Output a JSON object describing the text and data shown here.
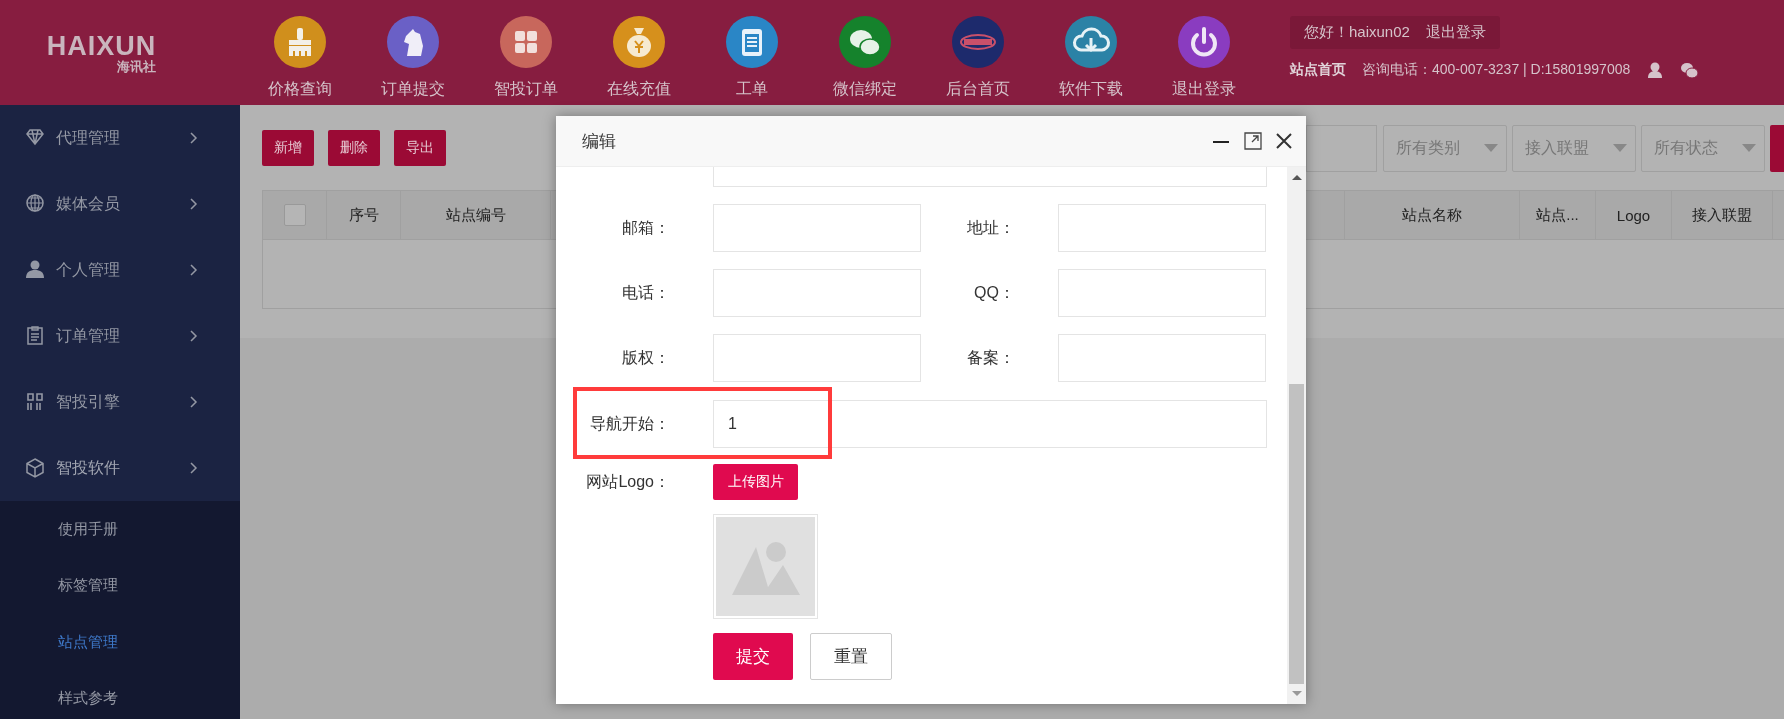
{
  "header": {
    "logo": {
      "text": "HAIXUN",
      "subtext": "海讯社"
    },
    "nav": [
      {
        "label": "价格查询",
        "kind": "brush",
        "color": "#d08f1c"
      },
      {
        "label": "订单提交",
        "kind": "horse",
        "color": "#6a60c6"
      },
      {
        "label": "智投订单",
        "kind": "grid",
        "color": "#c8675c"
      },
      {
        "label": "在线充值",
        "kind": "moneybag",
        "color": "#d6901c"
      },
      {
        "label": "工单",
        "kind": "clipboard",
        "color": "#2a86c6"
      },
      {
        "label": "微信绑定",
        "kind": "chat",
        "color": "#15822c"
      },
      {
        "label": "后台首页",
        "kind": "badge",
        "color": "#1d2a6c"
      },
      {
        "label": "软件下载",
        "kind": "cloud",
        "color": "#2b82a6"
      },
      {
        "label": "退出登录",
        "kind": "power",
        "color": "#8a3cc0"
      }
    ],
    "greeting": "您好！haixun02",
    "logout": "退出登录",
    "home_link": "站点首页",
    "contact": "咨询电话：400-007-3237 | D:15801997008"
  },
  "sidebar": {
    "items": [
      {
        "label": "代理管理",
        "kind": "diamond",
        "expanded": false
      },
      {
        "label": "媒体会员",
        "kind": "globe",
        "expanded": false
      },
      {
        "label": "个人管理",
        "kind": "person",
        "expanded": false
      },
      {
        "label": "订单管理",
        "kind": "clipboard",
        "expanded": false
      },
      {
        "label": "智投引擎",
        "kind": "bars",
        "expanded": false
      },
      {
        "label": "智投软件",
        "kind": "cube",
        "expanded": true,
        "children": [
          {
            "label": "使用手册",
            "selected": false
          },
          {
            "label": "标签管理",
            "selected": false
          },
          {
            "label": "站点管理",
            "selected": true
          },
          {
            "label": "样式参考",
            "selected": false
          }
        ]
      }
    ]
  },
  "toolbar": {
    "buttons": [
      "新增",
      "删除",
      "导出"
    ],
    "filters": [
      "所有类别",
      "接入联盟",
      "所有状态"
    ]
  },
  "table": {
    "select_all_checked": false,
    "columns_left": [
      "序号",
      "站点编号"
    ],
    "columns_right": [
      "站点名称",
      "站点...",
      "Logo",
      "接入联盟"
    ]
  },
  "dialog": {
    "title": "编辑",
    "rows": [
      [
        {
          "label": "邮箱："
        },
        {
          "label": "地址："
        }
      ],
      [
        {
          "label": "电话："
        },
        {
          "label": "QQ："
        }
      ],
      [
        {
          "label": "版权："
        },
        {
          "label": "备案："
        }
      ]
    ],
    "nav_start": {
      "label": "导航开始：",
      "value": "1",
      "highlighted": true
    },
    "logo": {
      "label": "网站Logo：",
      "button": "上传图片"
    },
    "actions": [
      {
        "label": "提交",
        "kind": "primary"
      },
      {
        "label": "重置",
        "kind": "secondary"
      }
    ]
  }
}
